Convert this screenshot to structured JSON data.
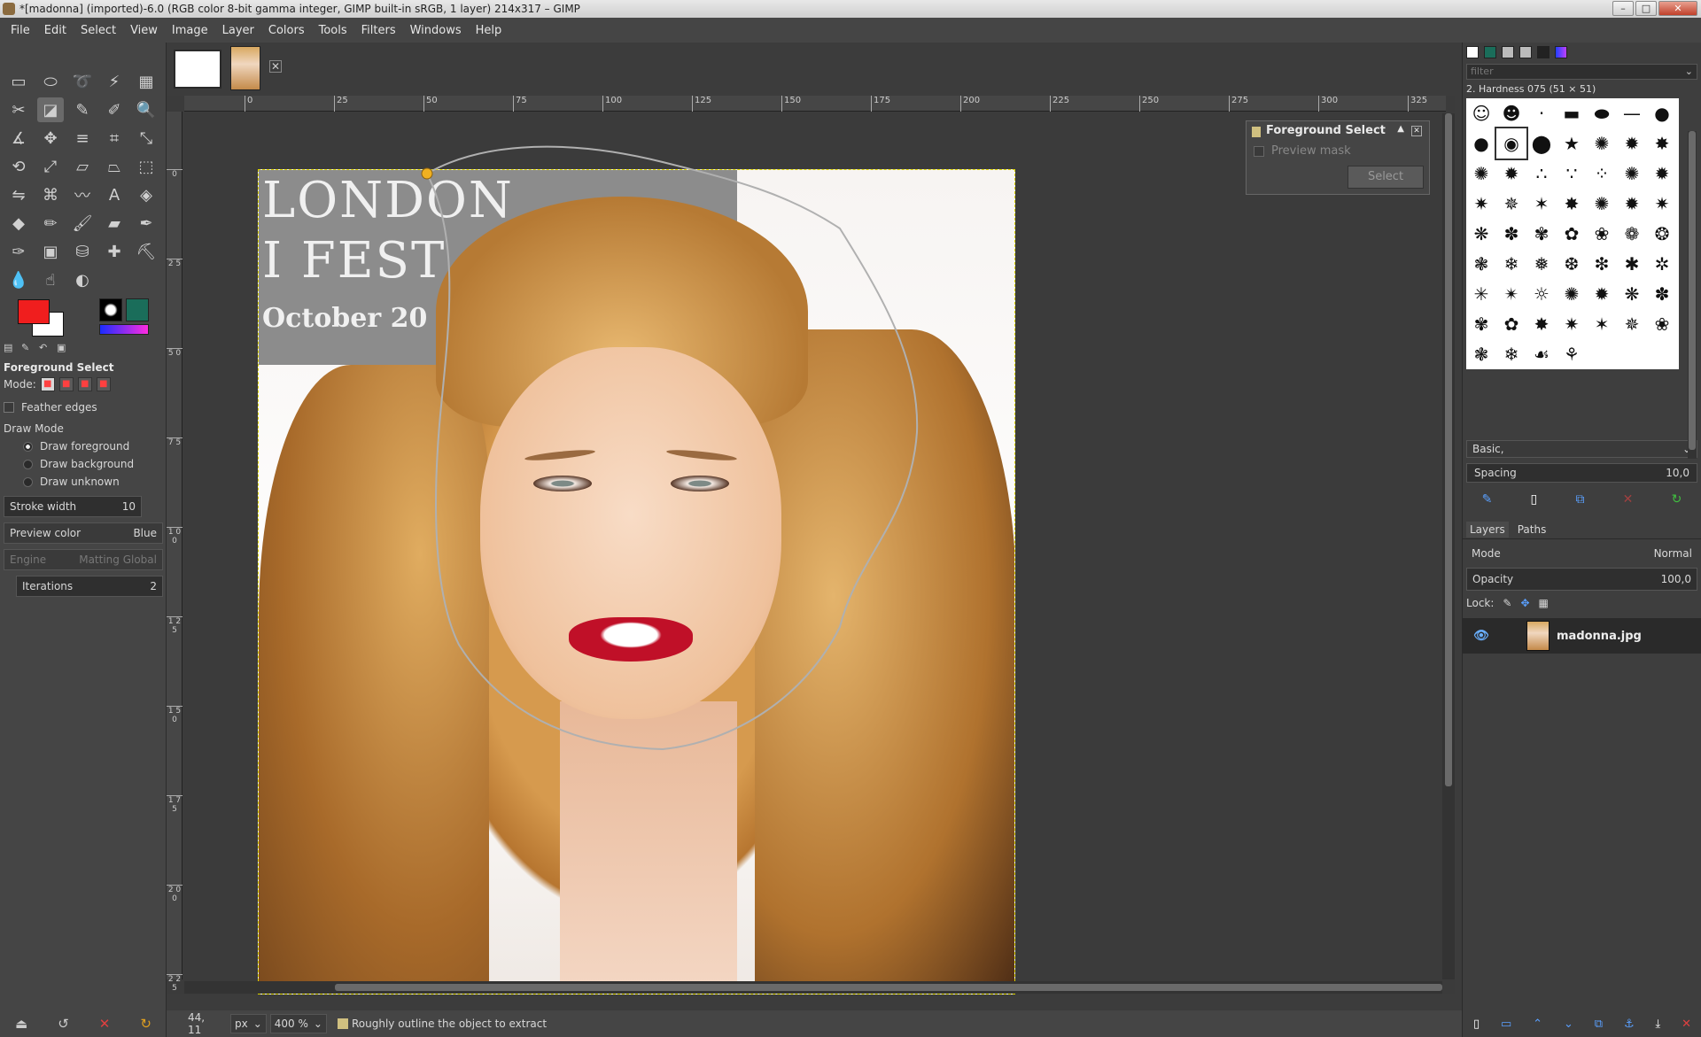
{
  "window": {
    "title": "*[madonna] (imported)-6.0 (RGB color 8-bit gamma integer, GIMP built-in sRGB, 1 layer) 214x317 – GIMP",
    "controls": [
      "–",
      "□",
      "✕"
    ]
  },
  "menu": [
    "File",
    "Edit",
    "Select",
    "View",
    "Image",
    "Layer",
    "Colors",
    "Tools",
    "Filters",
    "Windows",
    "Help"
  ],
  "tools": [
    {
      "name": "rect-select-icon",
      "glyph": "▭"
    },
    {
      "name": "ellipse-select-icon",
      "glyph": "⬭"
    },
    {
      "name": "free-select-icon",
      "glyph": "➰"
    },
    {
      "name": "fuzzy-select-icon",
      "glyph": "⚡"
    },
    {
      "name": "by-color-select-icon",
      "glyph": "▦"
    },
    {
      "name": "scissors-select-icon",
      "glyph": "✂"
    },
    {
      "name": "foreground-select-icon",
      "glyph": "◪",
      "active": true
    },
    {
      "name": "paths-icon",
      "glyph": "✎"
    },
    {
      "name": "color-picker-icon",
      "glyph": "✐"
    },
    {
      "name": "zoom-icon",
      "glyph": "🔍"
    },
    {
      "name": "measure-icon",
      "glyph": "∡"
    },
    {
      "name": "move-icon",
      "glyph": "✥"
    },
    {
      "name": "align-icon",
      "glyph": "≡"
    },
    {
      "name": "crop-icon",
      "glyph": "⌗"
    },
    {
      "name": "unified-transform-icon",
      "glyph": "⤡"
    },
    {
      "name": "rotate-icon",
      "glyph": "⟲"
    },
    {
      "name": "scale-icon",
      "glyph": "⤢"
    },
    {
      "name": "shear-icon",
      "glyph": "▱"
    },
    {
      "name": "perspective-icon",
      "glyph": "⏢"
    },
    {
      "name": "3d-transform-icon",
      "glyph": "⬚"
    },
    {
      "name": "flip-icon",
      "glyph": "⇋"
    },
    {
      "name": "cage-icon",
      "glyph": "⌘"
    },
    {
      "name": "warp-icon",
      "glyph": "〰"
    },
    {
      "name": "text-icon",
      "glyph": "A"
    },
    {
      "name": "bucket-fill-icon",
      "glyph": "◈"
    },
    {
      "name": "paintbrush-tilt-icon",
      "glyph": "◆"
    },
    {
      "name": "pencil-icon",
      "glyph": "✏"
    },
    {
      "name": "paintbrush-icon",
      "glyph": "🖌"
    },
    {
      "name": "eraser-icon",
      "glyph": "▰"
    },
    {
      "name": "airbrush-icon",
      "glyph": "✒"
    },
    {
      "name": "ink-icon",
      "glyph": "✑"
    },
    {
      "name": "mypaint-icon",
      "glyph": "▣"
    },
    {
      "name": "clone-icon",
      "glyph": "⛁"
    },
    {
      "name": "heal-icon",
      "glyph": "✚"
    },
    {
      "name": "perspective-clone-icon",
      "glyph": "⛏"
    },
    {
      "name": "blur-icon",
      "glyph": "💧"
    },
    {
      "name": "smudge-icon",
      "glyph": "☝"
    },
    {
      "name": "dodge-burn-icon",
      "glyph": "◐"
    }
  ],
  "tool_options": {
    "title": "Foreground Select",
    "mode_label": "Mode:",
    "feather_edges": "Feather edges",
    "draw_mode_label": "Draw Mode",
    "draw_options": [
      "Draw foreground",
      "Draw background",
      "Draw unknown"
    ],
    "stroke_width_label": "Stroke  width",
    "stroke_width_value": "10",
    "preview_color_label": "Preview color",
    "preview_color_value": "Blue",
    "engine_label": "Engine",
    "engine_value": "Matting Global",
    "iterations_label": "Iterations",
    "iterations_value": "2"
  },
  "rulers": {
    "h": [
      "0",
      "25",
      "50",
      "75",
      "100",
      "125",
      "150",
      "175",
      "200",
      "225",
      "250",
      "275",
      "300",
      "325"
    ],
    "v": [
      "0",
      "2 5",
      "5 0",
      "7 5",
      "1 0 0",
      "1 2 5",
      "1 5 0",
      "1 7 5",
      "2 0 0",
      "2 2 5"
    ]
  },
  "photo_text": {
    "line1": "LONDON",
    "line2": "I FEST",
    "line3": "October 20"
  },
  "fg_dialog": {
    "title": "Foreground Select",
    "preview_mask": "Preview mask",
    "select_button": "Select"
  },
  "status": {
    "coords": "44, 11",
    "unit": "px",
    "zoom": "400 %",
    "message": "Roughly outline the object to extract"
  },
  "dock": {
    "filter_placeholder": "filter",
    "brush_name": "2. Hardness 075 (51 × 51)",
    "brush_preset": "Basic,",
    "spacing_label": "Spacing",
    "spacing_value": "10,0",
    "layers_tab": "Layers",
    "paths_tab": "Paths",
    "mode_label": "Mode",
    "mode_value": "Normal",
    "opacity_label": "Opacity",
    "opacity_value": "100,0",
    "lock_label": "Lock:",
    "layer_name": "madonna.jpg"
  },
  "colors": {
    "foreground": "#f01e1e",
    "background": "#ffffff",
    "outline": "#b0b0b0",
    "handle": "#f0b020"
  }
}
